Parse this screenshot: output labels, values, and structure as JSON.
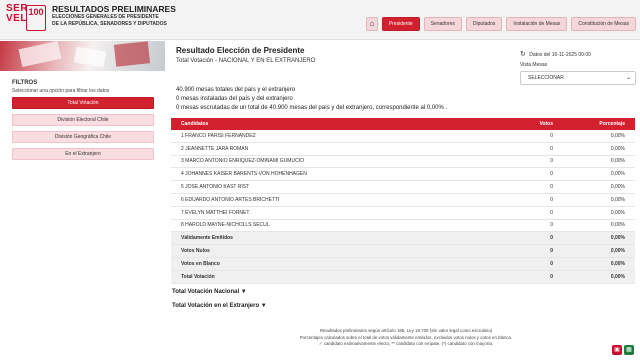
{
  "header": {
    "logo_text": "SER\nVEL",
    "badge_number": "100",
    "title": "RESULTADOS PRELIMINARES",
    "subtitle": "ELECCIONES GENERALES DE PRESIDENTE DE LA REPÚBLICA, SENADORES Y DIPUTADOS"
  },
  "nav": {
    "home_icon": "home-icon",
    "items": [
      "Presidente",
      "Senadores",
      "Diputados",
      "Instalación de Mesas",
      "Constitución de Mesas"
    ],
    "active": "Presidente"
  },
  "sidebar": {
    "title": "FILTROS",
    "help": "Seleccionar una opción para filtrar los datos",
    "options": [
      "Total Votación",
      "División Electoral Chile",
      "División Geográfica Chile",
      "En el Extranjero"
    ]
  },
  "main": {
    "title": "Resultado Elección de Presidente",
    "subtitle": "Total Votación - NACIONAL Y EN EL EXTRANJERO",
    "updated": "Datos del 16-11-2025 00:00",
    "vista_label": "Vista Mesas",
    "vista_value": "SELECCIONAR",
    "summary": [
      "40.900 mesas totales del país y el extranjero",
      "0 mesas instaladas del país y del extranjero",
      "0 mesas escrutadas de un total de 40.900 mesas del país y del extranjero, correspondiente al 0,00% ."
    ]
  },
  "table": {
    "headers": [
      "Candidatos",
      "Votos",
      "Porcentaje"
    ],
    "rows": [
      [
        "1 FRANCO PARISI FERNANDEZ",
        "0",
        "0,00%"
      ],
      [
        "2 JEANNETTE JARA ROMAN",
        "0",
        "0,00%"
      ],
      [
        "3 MARCO ANTONIO ENRIQUEZ-OMINAMI GUMUCIO",
        "0",
        "0,00%"
      ],
      [
        "4 JOHANNES KAISER BARENTS-VON HOHENHAGEN",
        "0",
        "0,00%"
      ],
      [
        "5 JOSE ANTONIO KAST RIST",
        "0",
        "0,00%"
      ],
      [
        "6 EDUARDO ANTONIO ARTES BRICHETTI",
        "0",
        "0,00%"
      ],
      [
        "7 EVELYN MATTHEI FORNET",
        "0",
        "0,00%"
      ],
      [
        "8 HAROLD MAYNE-NICHOLLS SECUL",
        "0",
        "0,00%"
      ]
    ],
    "totals": [
      [
        "Válidamente Emitidos",
        "0",
        "0,00%"
      ],
      [
        "Votos Nulos",
        "0",
        "0,00%"
      ],
      [
        "Votos en Blanco",
        "0",
        "0,00%"
      ],
      [
        "Total Votación",
        "0",
        "0,00%"
      ]
    ]
  },
  "sections": [
    "Total Votación Nacional ▼",
    "Total Votación en el Extranjero ▼"
  ],
  "footer": [
    "Resultados preliminares según artículo 185, Ley 18.700 (Sin valor legal como escrutinio)",
    "Porcentajes calculados sobre el total de votos válidamente emitidos, excluidos votos nulos y votos en blanco.",
    "✓ candidato estimativamente electo, ** candidato con empate, (*) candidato con mayoría."
  ],
  "colors": {
    "accent": "#d3202e",
    "pdf": "#c8102e",
    "excel": "#1f7a3d"
  }
}
